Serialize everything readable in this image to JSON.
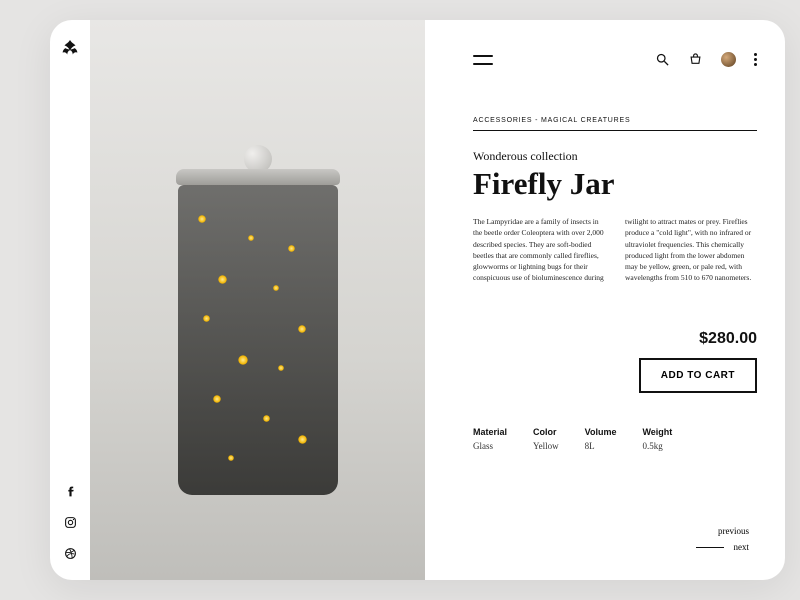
{
  "breadcrumb": "ACCESSORIES - MAGICAL CREATURES",
  "collection": "Wonderous collection",
  "title": "Firefly Jar",
  "description": "The Lampyridae are a family of insects in the beetle order Coleoptera with over 2,000 described species. They are soft-bodied beetles that are commonly called fireflies, glowworms or lightning bugs for their conspicuous use of bioluminescence during twilight to attract mates or prey. Fireflies produce a \"cold light\", with no infrared or ultraviolet frequencies. This chemically produced light from the lower abdomen may be yellow, green, or pale red, with wavelengths from 510 to 670 nanometers.",
  "price": "$280.00",
  "add_to_cart": "ADD TO CART",
  "specs": {
    "material": {
      "label": "Material",
      "value": "Glass"
    },
    "color": {
      "label": "Color",
      "value": "Yellow"
    },
    "volume": {
      "label": "Volume",
      "value": "8L"
    },
    "weight": {
      "label": "Weight",
      "value": "0.5kg"
    }
  },
  "nav": {
    "previous": "previous",
    "next": "next"
  }
}
